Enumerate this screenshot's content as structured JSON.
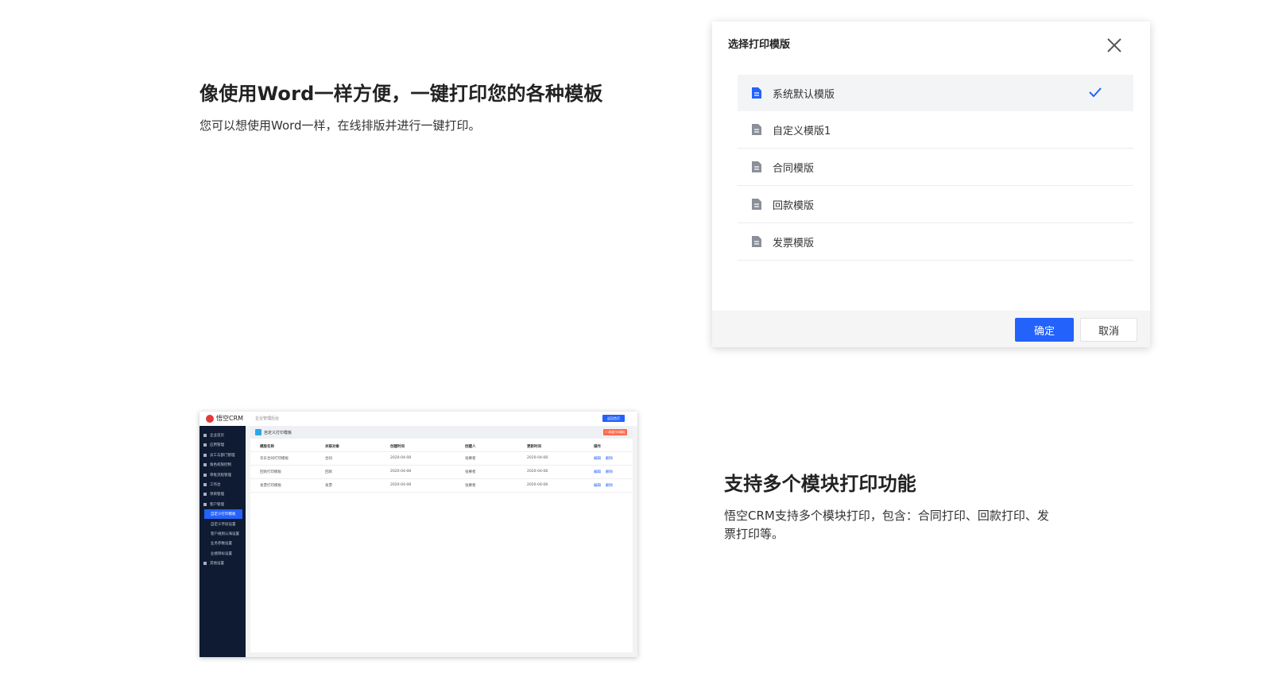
{
  "section1": {
    "title": "像使用Word一样方便，一键打印您的各种模板",
    "desc": "您可以想使用Word一样，在线排版并进行一键打印。"
  },
  "dialog": {
    "title": "选择打印模版",
    "templates": [
      {
        "label": "系统默认模版",
        "selected": true
      },
      {
        "label": "自定义模版1",
        "selected": false
      },
      {
        "label": "合同模版",
        "selected": false
      },
      {
        "label": "回款模版",
        "selected": false
      },
      {
        "label": "发票模版",
        "selected": false
      }
    ],
    "ok_label": "确定",
    "cancel_label": "取消",
    "accent": "#2362fb"
  },
  "section2": {
    "title": "支持多个模块打印功能",
    "desc_line1": "悟空CRM支持多个模块打印，包含：合同打印、回款打印、发",
    "desc_line2": "票打印等。"
  },
  "crm": {
    "logo": "悟空CRM",
    "subtitle": "企业管理后台",
    "top_button": "返回首页",
    "sidebar": [
      {
        "label": "企业首页",
        "sub": false,
        "active": false
      },
      {
        "label": "应用管理",
        "sub": false,
        "active": false
      },
      {
        "label": "员工与部门管理",
        "sub": false,
        "active": false
      },
      {
        "label": "角色权限控制",
        "sub": false,
        "active": false
      },
      {
        "label": "审批流程管理",
        "sub": false,
        "active": false
      },
      {
        "label": "工作台",
        "sub": false,
        "active": false
      },
      {
        "label": "项目管理",
        "sub": false,
        "active": false
      },
      {
        "label": "客户管理",
        "sub": false,
        "active": false
      },
      {
        "label": "自定义打印模板",
        "sub": true,
        "active": true
      },
      {
        "label": "自定义字段设置",
        "sub": true,
        "active": false
      },
      {
        "label": "客户规则公海设置",
        "sub": true,
        "active": false
      },
      {
        "label": "业务参数设置",
        "sub": true,
        "active": false
      },
      {
        "label": "业绩目标设置",
        "sub": true,
        "active": false
      },
      {
        "label": "其他设置",
        "sub": false,
        "active": false
      }
    ],
    "page_title": "自定义打印模板",
    "new_button": "+ 新建打印模板",
    "columns": [
      "模版名称",
      "关联对象",
      "创建时间",
      "创建人",
      "更新时间",
      "操作"
    ],
    "rows": [
      {
        "name": "华东合同打印模板",
        "object": "合同",
        "created": "2020-04-08",
        "creator": "张赛者",
        "updated": "2020-04-08",
        "edit": "编辑",
        "delete": "删除"
      },
      {
        "name": "回款打印模板",
        "object": "回款",
        "created": "2020-04-08",
        "creator": "张赛者",
        "updated": "2020-04-08",
        "edit": "编辑",
        "delete": "删除"
      },
      {
        "name": "发票打印模板",
        "object": "发票",
        "created": "2020-04-08",
        "creator": "张赛者",
        "updated": "2020-04-08",
        "edit": "编辑",
        "delete": "删除"
      }
    ]
  }
}
